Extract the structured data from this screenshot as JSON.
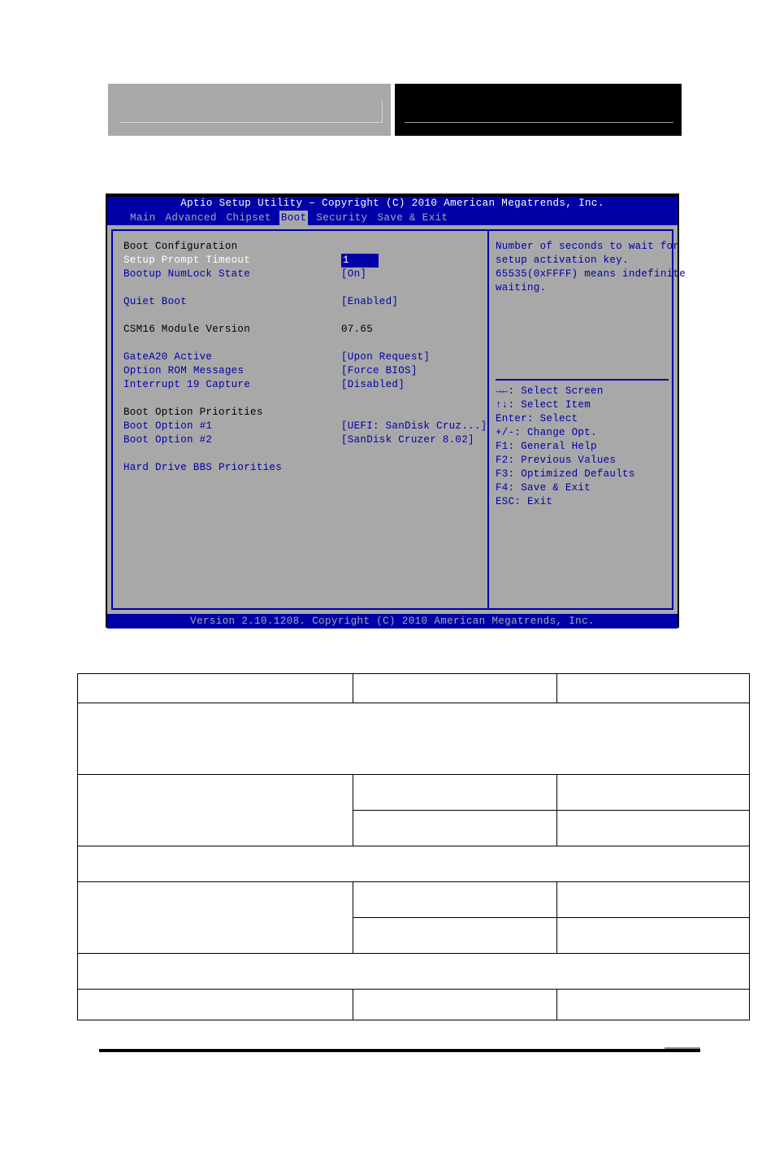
{
  "header": {
    "left_box": {
      "fill": "#a8a8a8",
      "rule_color": "#d3d3d3"
    },
    "right_box": {
      "fill": "#000000",
      "rule_color": "#9a9a9a"
    }
  },
  "bios": {
    "title": "Aptio Setup Utility – Copyright (C) 2010 American Megatrends, Inc.",
    "footer": "Version 2.10.1208. Copyright (C) 2010 American Megatrends, Inc.",
    "colors": {
      "blue": "#0000a8",
      "gray": "#a8a8a8",
      "white": "#ffffff",
      "black": "#000000"
    },
    "menu": [
      {
        "label": "Main",
        "selected": false
      },
      {
        "label": "Advanced",
        "selected": false
      },
      {
        "label": "Chipset",
        "selected": false
      },
      {
        "label": "Boot",
        "selected": true
      },
      {
        "label": "Security",
        "selected": false
      },
      {
        "label": "Save & Exit",
        "selected": false
      }
    ],
    "options": [
      {
        "label": "Boot Configuration",
        "value": "",
        "label_color": "black",
        "value_kind": "none"
      },
      {
        "label": "Setup Prompt Timeout",
        "value": "1",
        "label_color": "white",
        "value_kind": "highlight"
      },
      {
        "label": "Bootup NumLock State",
        "value": "[On]",
        "label_color": "blue",
        "value_kind": "plain"
      },
      {
        "label": "",
        "value": "",
        "label_color": "blue",
        "value_kind": "none"
      },
      {
        "label": "Quiet Boot",
        "value": "[Enabled]",
        "label_color": "blue",
        "value_kind": "plain"
      },
      {
        "label": "",
        "value": "",
        "label_color": "blue",
        "value_kind": "none"
      },
      {
        "label": "CSM16 Module Version",
        "value": "07.65",
        "label_color": "black",
        "value_kind": "plain-black"
      },
      {
        "label": "",
        "value": "",
        "label_color": "blue",
        "value_kind": "none"
      },
      {
        "label": "GateA20 Active",
        "value": "[Upon Request]",
        "label_color": "blue",
        "value_kind": "plain"
      },
      {
        "label": "Option ROM Messages",
        "value": "[Force BIOS]",
        "label_color": "blue",
        "value_kind": "plain"
      },
      {
        "label": "Interrupt 19 Capture",
        "value": "[Disabled]",
        "label_color": "blue",
        "value_kind": "plain"
      },
      {
        "label": "",
        "value": "",
        "label_color": "blue",
        "value_kind": "none"
      },
      {
        "label": "Boot Option Priorities",
        "value": "",
        "label_color": "black",
        "value_kind": "none"
      },
      {
        "label": "Boot Option #1",
        "value": "[UEFI: SanDisk Cruz...]",
        "label_color": "blue",
        "value_kind": "plain"
      },
      {
        "label": "Boot Option #2",
        "value": "[SanDisk Cruzer 8.02]",
        "label_color": "blue",
        "value_kind": "plain"
      },
      {
        "label": "",
        "value": "",
        "label_color": "blue",
        "value_kind": "none"
      },
      {
        "label": "Hard Drive BBS Priorities",
        "value": "",
        "label_color": "blue",
        "value_kind": "none"
      }
    ],
    "help": [
      "Number of seconds to wait for",
      "setup activation key.",
      "65535(0xFFFF) means indefinite",
      "waiting."
    ],
    "keys": [
      "→←: Select Screen",
      "↑↓: Select Item",
      "Enter: Select",
      "+/-: Change Opt.",
      "F1: General Help",
      "F2: Previous Values",
      "F3: Optimized Defaults",
      "F4: Save & Exit",
      "ESC: Exit"
    ]
  },
  "spec_table": {
    "rows": [
      {
        "kind": "three",
        "cells": [
          "",
          "",
          ""
        ],
        "height": "r-h"
      },
      {
        "kind": "full",
        "cells": [
          ""
        ],
        "height": "r-tall"
      },
      {
        "kind": "three-rowspan",
        "cells": [
          "",
          "",
          "",
          "",
          ""
        ],
        "height": "r-med"
      },
      {
        "kind": "full",
        "cells": [
          ""
        ],
        "height": "r-med"
      },
      {
        "kind": "three-rowspan2",
        "cells": [
          "",
          "",
          "",
          "",
          ""
        ],
        "height": "r-med"
      },
      {
        "kind": "full",
        "cells": [
          ""
        ],
        "height": "r-med"
      },
      {
        "kind": "three",
        "cells": [
          "",
          "",
          ""
        ],
        "height": "r-sm"
      }
    ]
  }
}
